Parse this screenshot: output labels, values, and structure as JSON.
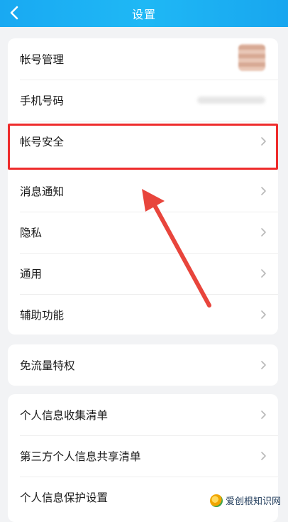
{
  "header": {
    "title": "设置"
  },
  "colors": {
    "header_bg": "#19a9f2",
    "highlight": "#ee2c2c",
    "text": "#1a1a1a"
  },
  "group1": {
    "items": [
      {
        "label": "帐号管理"
      },
      {
        "label": "手机号码"
      },
      {
        "label": "帐号安全"
      },
      {
        "label": "消息通知"
      },
      {
        "label": "隐私"
      },
      {
        "label": "通用"
      },
      {
        "label": "辅助功能"
      }
    ]
  },
  "group2": {
    "items": [
      {
        "label": "免流量特权"
      }
    ]
  },
  "group3": {
    "items": [
      {
        "label": "个人信息收集清单"
      },
      {
        "label": "第三方个人信息共享清单"
      },
      {
        "label": "个人信息保护设置"
      }
    ]
  },
  "watermark": {
    "text": "爱创根知识网"
  }
}
